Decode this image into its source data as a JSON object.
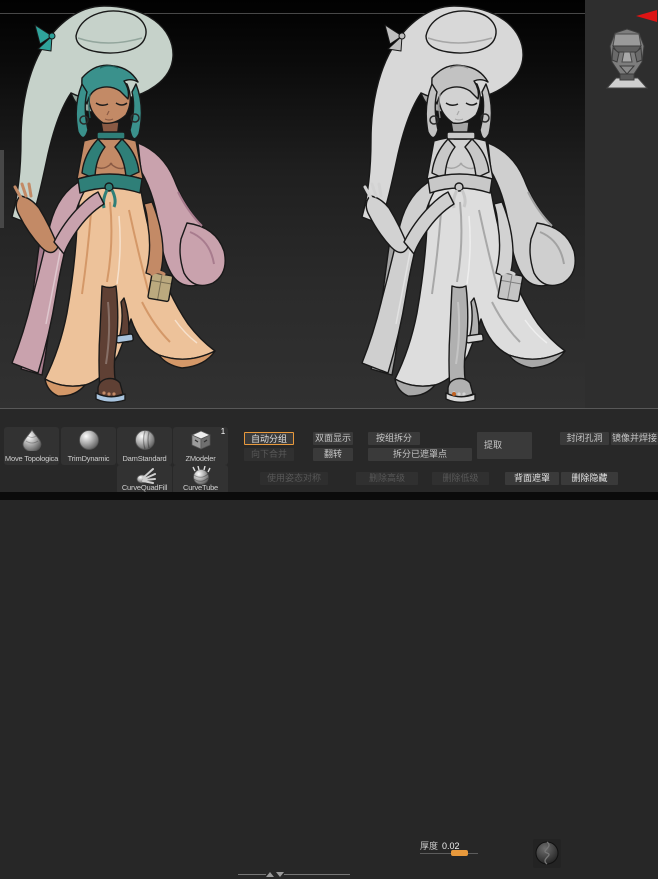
{
  "canvas": {
    "models": [
      {
        "id": "colored",
        "label": "彩色角色模型"
      },
      {
        "id": "clay",
        "label": "灰色黏土角色模型"
      }
    ]
  },
  "tray": {
    "collapse_icon": "red-left-triangle",
    "tool_thumbnail": "low-poly-head"
  },
  "brush_shelf": {
    "row1": [
      {
        "label": "Move Topologica",
        "icon": "teardrop-mesh-brush-icon"
      },
      {
        "label": "TrimDynamic",
        "icon": "smooth-sphere-brush-icon"
      },
      {
        "label": "DamStandard",
        "icon": "grooved-sphere-brush-icon"
      },
      {
        "label": "ZModeler",
        "icon": "cube-arrows-brush-icon",
        "badge": "1"
      }
    ],
    "row2": [
      {
        "label": "CurveQuadFill",
        "icon": "hand-splat-brush-icon"
      },
      {
        "label": "CurveTube",
        "icon": "spiky-tube-brush-icon"
      }
    ]
  },
  "geometry_panel": {
    "row1": [
      {
        "label": "自动分组",
        "highlighted": true
      },
      {
        "label": "双面显示"
      },
      {
        "label": "按组拆分"
      }
    ],
    "thickness": {
      "label": "厚度",
      "value": "0.02"
    },
    "extract": {
      "label": "提取"
    },
    "sphere_icon": "subtool-sphere-icon",
    "row2": [
      {
        "label": "向下合并",
        "disabled": true
      },
      {
        "label": "翻转"
      },
      {
        "label": "拆分已遮罩点"
      }
    ],
    "right_buttons": [
      {
        "label": "封闭孔洞"
      },
      {
        "label": "镜像并焊接"
      }
    ],
    "row3": [
      {
        "label": "使用姿态对称",
        "disabled": true
      },
      {
        "label": "删除高级",
        "disabled": true
      },
      {
        "label": "删除低级",
        "disabled": true
      },
      {
        "label": "背面遮罩"
      },
      {
        "label": "删除隐藏"
      }
    ]
  },
  "colors": {
    "accent_orange": "#e8993c",
    "collapse_red": "#dd1414",
    "hat_green": "#c6d2ca",
    "hair_teal": "#3a918c",
    "dress_peach": "#edc29a",
    "robe_pink": "#c9a2ad",
    "clay_gray": "#d2d2d2"
  }
}
